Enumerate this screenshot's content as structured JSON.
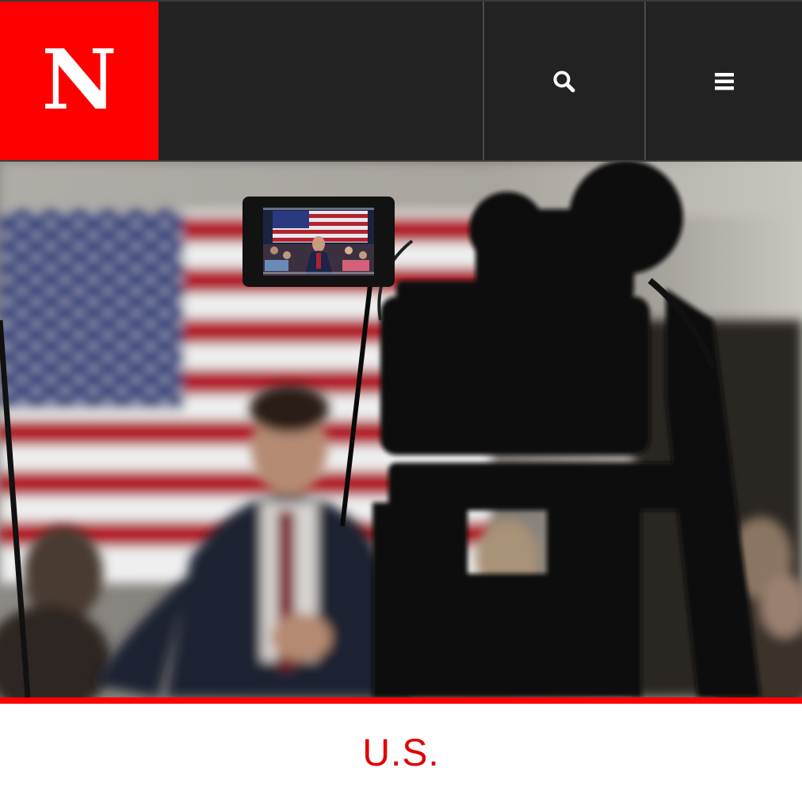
{
  "header": {
    "logo_text": "N",
    "search_icon": "search-icon",
    "menu_icon": "hamburger-menu-icon"
  },
  "hero": {
    "image": "campaign-event-camera-photo"
  },
  "section": {
    "label": "U.S."
  },
  "colors": {
    "brand_red": "#ff0000",
    "section_red": "#e00000",
    "header_bg": "#222222"
  }
}
